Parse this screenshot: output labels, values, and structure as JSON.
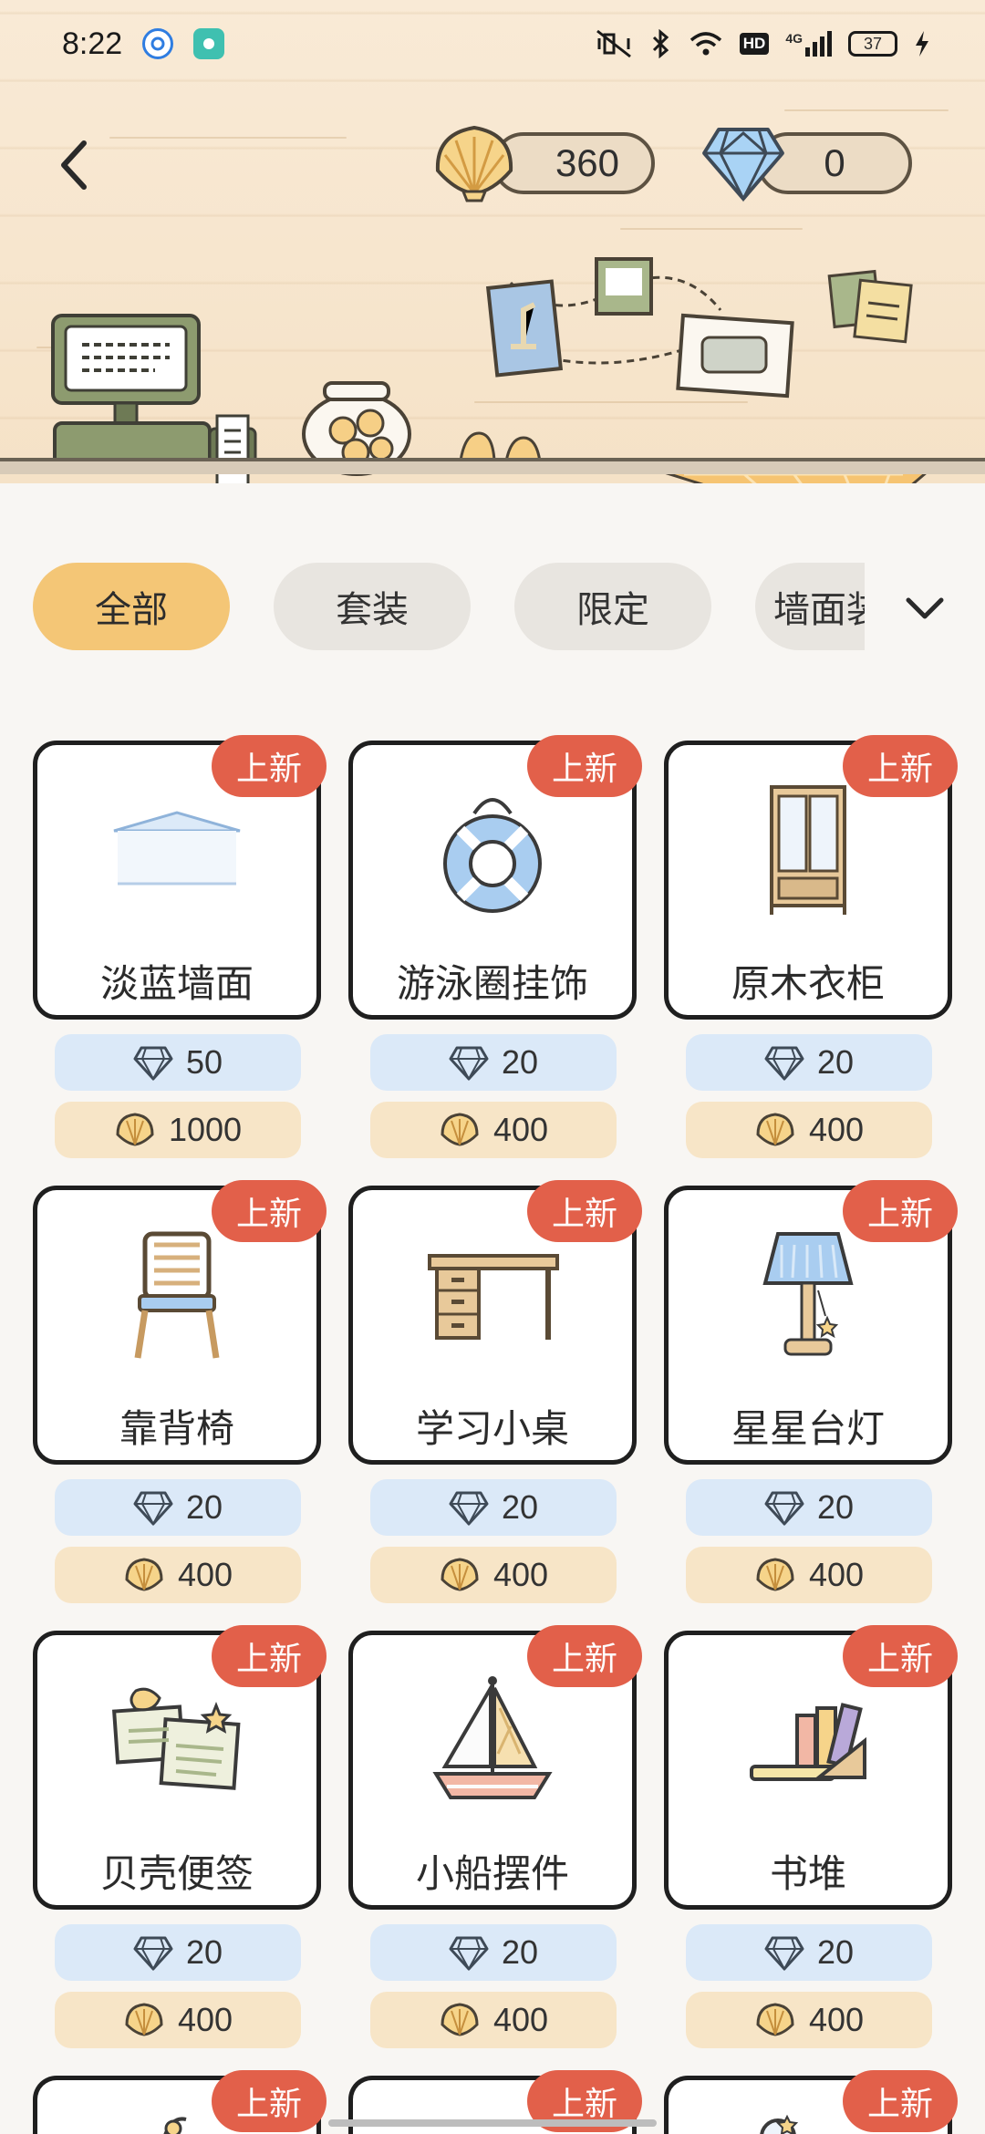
{
  "status_bar": {
    "time": "8:22",
    "battery": "37",
    "network": "4G",
    "hd": "HD"
  },
  "header": {
    "shells": "360",
    "diamonds": "0"
  },
  "tabs": [
    {
      "label": "全部",
      "active": true
    },
    {
      "label": "套装",
      "active": false
    },
    {
      "label": "限定",
      "active": false
    },
    {
      "label": "墙面装",
      "active": false
    }
  ],
  "items": [
    {
      "name": "淡蓝墙面",
      "badge": "上新",
      "diamond": "50",
      "shell": "1000",
      "icon": "blue-wall-icon"
    },
    {
      "name": "游泳圈挂饰",
      "badge": "上新",
      "diamond": "20",
      "shell": "400",
      "icon": "swim-ring-icon"
    },
    {
      "name": "原木衣柜",
      "badge": "上新",
      "diamond": "20",
      "shell": "400",
      "icon": "wardrobe-icon"
    },
    {
      "name": "靠背椅",
      "badge": "上新",
      "diamond": "20",
      "shell": "400",
      "icon": "chair-icon"
    },
    {
      "name": "学习小桌",
      "badge": "上新",
      "diamond": "20",
      "shell": "400",
      "icon": "desk-icon"
    },
    {
      "name": "星星台灯",
      "badge": "上新",
      "diamond": "20",
      "shell": "400",
      "icon": "lamp-icon"
    },
    {
      "name": "贝壳便签",
      "badge": "上新",
      "diamond": "20",
      "shell": "400",
      "icon": "memo-icon"
    },
    {
      "name": "小船摆件",
      "badge": "上新",
      "diamond": "20",
      "shell": "400",
      "icon": "sailboat-icon"
    },
    {
      "name": "书堆",
      "badge": "上新",
      "diamond": "20",
      "shell": "400",
      "icon": "books-icon"
    }
  ],
  "partial_row_badge": "上新",
  "colors": {
    "accent_tab": "#f4c676",
    "badge": "#e2604a",
    "diamond_bg": "#dbe9f8",
    "shell_bg": "#f7e5c7"
  }
}
